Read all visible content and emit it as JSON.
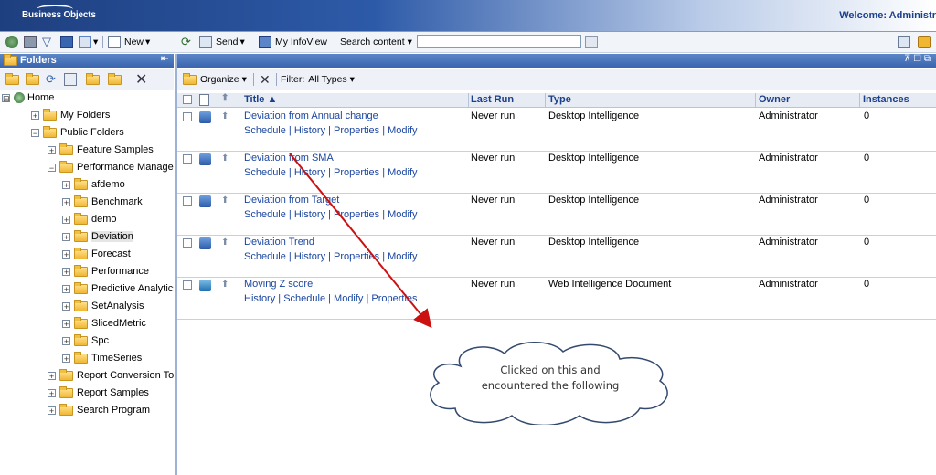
{
  "banner": {
    "logo": "Business Objects",
    "welcome": "Welcome: Administr"
  },
  "toolbar": {
    "new_label": "New",
    "send_label": "Send",
    "infoview_label": "My InfoView",
    "search_label": "Search content",
    "search_value": ""
  },
  "left_pane": {
    "title": "Folders",
    "tree": [
      {
        "label": "Home",
        "sign": "⊟"
      },
      {
        "label": "My Folders",
        "sign": "+"
      },
      {
        "label": "Public Folders",
        "sign": "−"
      },
      {
        "label": "Feature Samples",
        "sign": "+"
      },
      {
        "label": "Performance Managei",
        "sign": "−"
      },
      {
        "label": "afdemo",
        "sign": "+"
      },
      {
        "label": "Benchmark",
        "sign": "+"
      },
      {
        "label": "demo",
        "sign": "+"
      },
      {
        "label": "Deviation",
        "sign": "+"
      },
      {
        "label": "Forecast",
        "sign": "+"
      },
      {
        "label": "Performance",
        "sign": "+"
      },
      {
        "label": "Predictive Analytics",
        "sign": "+"
      },
      {
        "label": "SetAnalysis",
        "sign": "+"
      },
      {
        "label": "SlicedMetric",
        "sign": "+"
      },
      {
        "label": "Spc",
        "sign": "+"
      },
      {
        "label": "TimeSeries",
        "sign": "+"
      },
      {
        "label": "Report Conversion To",
        "sign": "+"
      },
      {
        "label": "Report Samples",
        "sign": "+"
      },
      {
        "label": "Search Program",
        "sign": "+"
      }
    ]
  },
  "right_pane": {
    "organize_label": "Organize",
    "filter_label": "Filter:",
    "filter_value": "All Types",
    "columns": [
      "Title ▲",
      "Last Run",
      "Type",
      "Owner",
      "Instances"
    ],
    "rows": [
      {
        "title": "Deviation from Annual change",
        "links": "Schedule | History | Properties | Modify",
        "last_run": "Never run",
        "type": "Desktop Intelligence",
        "owner": "Administrator",
        "instances": "0"
      },
      {
        "title": "Deviation from SMA",
        "links": "Schedule | History | Properties | Modify",
        "last_run": "Never run",
        "type": "Desktop Intelligence",
        "owner": "Administrator",
        "instances": "0"
      },
      {
        "title": "Deviation from Target",
        "links": "Schedule | History | Properties | Modify",
        "last_run": "Never run",
        "type": "Desktop Intelligence",
        "owner": "Administrator",
        "instances": "0"
      },
      {
        "title": "Deviation Trend",
        "links": "Schedule | History | Properties | Modify",
        "last_run": "Never run",
        "type": "Desktop Intelligence",
        "owner": "Administrator",
        "instances": "0"
      },
      {
        "title": "Moving Z score",
        "links": "History | Schedule | Modify | Properties",
        "last_run": "Never run",
        "type": "Web Intelligence Document",
        "owner": "Administrator",
        "instances": "0"
      }
    ]
  },
  "annotation": {
    "line1": "Clicked on this and",
    "line2": "encountered the following",
    "color": "#cc1111"
  }
}
